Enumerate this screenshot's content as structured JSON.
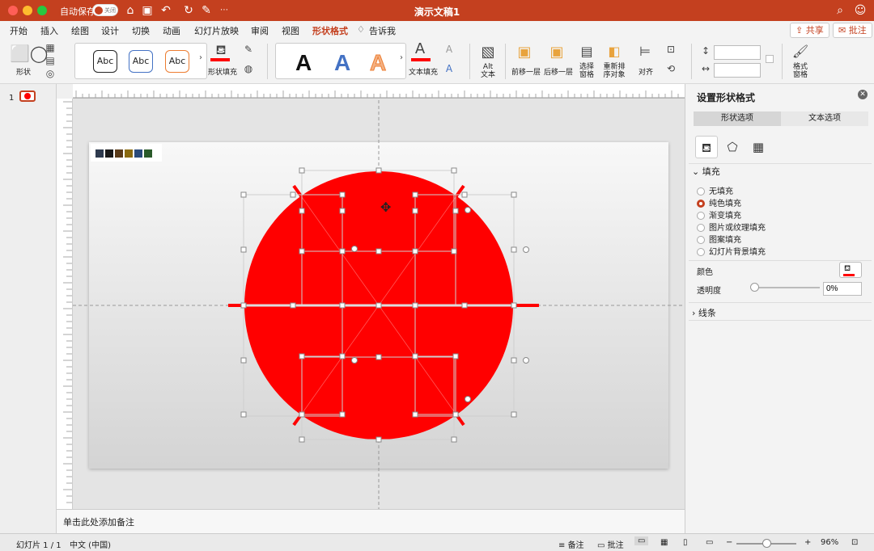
{
  "titlebar": {
    "autosave_label": "自动保存",
    "autosave_state": "关闭",
    "doc_title": "演示文稿1"
  },
  "menu": {
    "tabs": [
      "开始",
      "插入",
      "绘图",
      "设计",
      "切换",
      "动画",
      "幻灯片放映",
      "审阅",
      "视图",
      "形状格式",
      "告诉我"
    ],
    "active_tab": "形状格式",
    "share": "共享",
    "comments": "批注"
  },
  "ribbon": {
    "shapes_label": "形状",
    "style_samples": [
      "Abc",
      "Abc",
      "Abc"
    ],
    "shape_fill_label": "形状填充",
    "wordart_samples": [
      "A",
      "A",
      "A"
    ],
    "text_fill_label": "文本填充",
    "alt_text_label": "Alt\n文本",
    "bring_forward": "前移一层",
    "send_backward": "后移一层",
    "selection_pane": "选择\n窗格",
    "reorder": "重新排\n序对象",
    "align": "对齐",
    "format_pane": "格式\n窗格",
    "height_value": "",
    "width_value": ""
  },
  "thumbs": {
    "slide_number": "1"
  },
  "notes": {
    "placeholder": "单击此处添加备注"
  },
  "format_pane": {
    "title": "设置形状格式",
    "seg_shape": "形状选项",
    "seg_text": "文本选项",
    "fill_section": "填充",
    "fill_options": [
      "无填充",
      "纯色填充",
      "渐变填充",
      "图片或纹理填充",
      "图案填充",
      "幻灯片背景填充"
    ],
    "fill_selected": "纯色填充",
    "color_label": "颜色",
    "transparency_label": "透明度",
    "transparency_value": "0%",
    "line_section": "线条"
  },
  "statusbar": {
    "slide_info": "幻灯片 1 / 1",
    "language": "中文 (中国)",
    "notes": "备注",
    "comments": "批注",
    "zoom": "96%"
  },
  "colors": {
    "accent": "#c4401f",
    "shape_fill": "#ff0000",
    "swatches": [
      "#2e3a4e",
      "#1a1a1a",
      "#5a3b1a",
      "#8a6a10",
      "#2a4a7a",
      "#2a5a2a"
    ]
  }
}
